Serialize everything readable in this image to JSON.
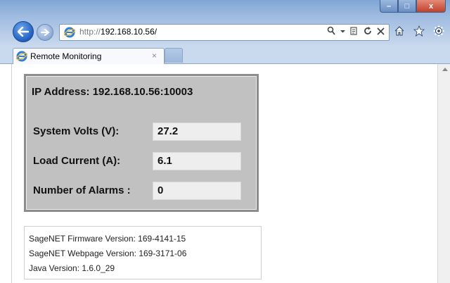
{
  "browser": {
    "url_protocol": "http://",
    "url_host": "192.168.10.56/",
    "tab_title": "Remote Monitoring",
    "tab_close": "×",
    "window_buttons": {
      "minimize": "–",
      "maximize": "□",
      "close": "x"
    },
    "address_tools": [
      "search-icon",
      "dropdown-icon",
      "compatibility-icon",
      "refresh-icon",
      "stop-icon"
    ],
    "right_icons": [
      "home-icon",
      "favorites-star-icon",
      "settings-gear-icon"
    ]
  },
  "monitor": {
    "ip_label": "IP Address: 192.168.10.56:10003",
    "fields": [
      {
        "label": "System Volts (V):",
        "value": "27.2"
      },
      {
        "label": "Load Current (A):",
        "value": "6.1"
      },
      {
        "label": "Number of Alarms :",
        "value": "0"
      }
    ]
  },
  "versions": [
    "SageNET Firmware Version: 169-4141-15",
    "SageNET Webpage Version: 169-3171-06",
    "Java Version: 1.6.0_29"
  ],
  "colors": {
    "panel_bg": "#c1c1c1",
    "panel_border": "#8d8d8d",
    "field_bg": "#eeeeee",
    "titlebar": "#9fbbe0",
    "close_button": "#c0412a"
  }
}
